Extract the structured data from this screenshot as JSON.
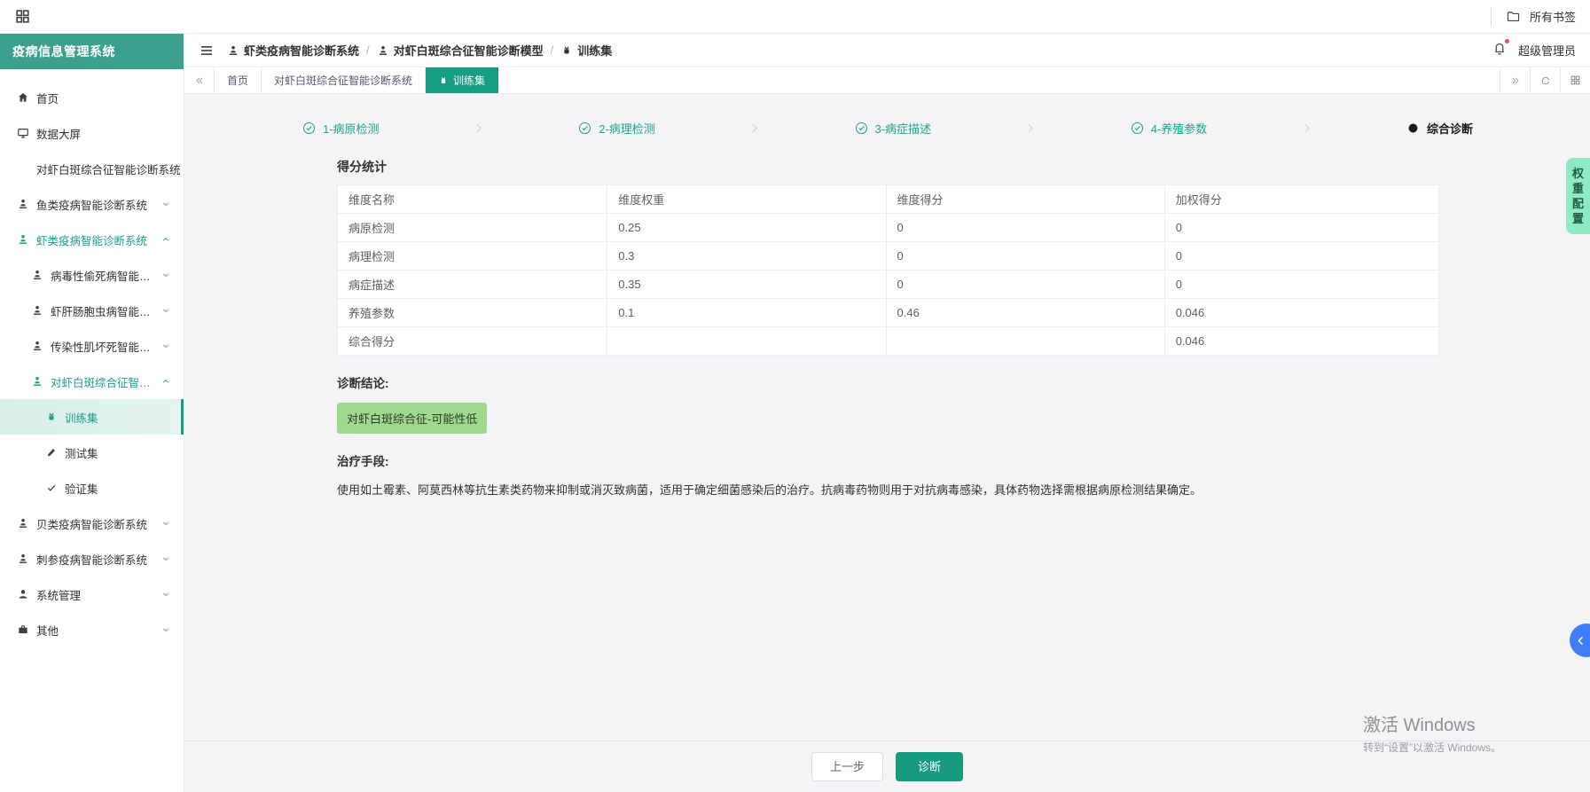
{
  "browser_bar": {
    "bookmarks_label": "所有书签"
  },
  "colors": {
    "teal_header": "#3ca08e",
    "accent": "#189e85",
    "badge_green": "#9fd98d",
    "drawer_blue": "#3f7ef7"
  },
  "sidebar": {
    "title": "疫病信息管理系统",
    "items": [
      {
        "id": "home",
        "label": "首页",
        "icon": "home",
        "level": 1
      },
      {
        "id": "data-screen",
        "label": "数据大屏",
        "icon": "screen",
        "level": 1
      },
      {
        "id": "wssd-system-link",
        "label": "对虾白斑综合征智能诊断系统",
        "icon": null,
        "level": 1
      },
      {
        "id": "fish-system",
        "label": "鱼类疫病智能诊断系统",
        "icon": "model",
        "level": 1,
        "chevron": "down"
      },
      {
        "id": "shrimp-system",
        "label": "虾类疫病智能诊断系统",
        "icon": "model",
        "level": 1,
        "chevron": "up",
        "active": true
      },
      {
        "id": "viral-covert-mortality-model",
        "label": "病毒性偷死病智能诊断模型",
        "icon": "model",
        "level": 2,
        "chevron": "down"
      },
      {
        "id": "ehp-model",
        "label": "虾肝肠胞虫病智能诊断模型",
        "icon": "model",
        "level": 2,
        "chevron": "down"
      },
      {
        "id": "imn-model",
        "label": "传染性肌坏死智能诊断模型",
        "icon": "model",
        "level": 2,
        "chevron": "down"
      },
      {
        "id": "wssd-model",
        "label": "对虾白斑综合征智能诊断模型",
        "icon": "model",
        "level": 2,
        "chevron": "up",
        "active": true
      },
      {
        "id": "training-set",
        "label": "训练集",
        "icon": "android",
        "level": 3,
        "selected": true
      },
      {
        "id": "test-set",
        "label": "测试集",
        "icon": "pencil",
        "level": 3
      },
      {
        "id": "validation-set",
        "label": "验证集",
        "icon": "check",
        "level": 3
      },
      {
        "id": "shellfish-system",
        "label": "贝类疫病智能诊断系统",
        "icon": "model",
        "level": 1,
        "chevron": "down"
      },
      {
        "id": "sea-cucumber-system",
        "label": "刺参疫病智能诊断系统",
        "icon": "model",
        "level": 1,
        "chevron": "down"
      },
      {
        "id": "system-management",
        "label": "系统管理",
        "icon": "user",
        "level": 1,
        "chevron": "down"
      },
      {
        "id": "other",
        "label": "其他",
        "icon": "briefcase",
        "level": 1,
        "chevron": "down"
      }
    ]
  },
  "header": {
    "breadcrumb": [
      {
        "label": "虾类疫病智能诊断系统",
        "icon": "model"
      },
      {
        "label": "对虾白斑综合征智能诊断模型",
        "icon": "model"
      },
      {
        "label": "训练集",
        "icon": "android"
      }
    ],
    "user": "超级管理员"
  },
  "tabs": [
    {
      "id": "home",
      "label": "首页"
    },
    {
      "id": "wssd-system",
      "label": "对虾白斑综合征智能诊断系统"
    },
    {
      "id": "training-set",
      "label": "训练集",
      "icon": "android",
      "active": true
    }
  ],
  "stepper": [
    {
      "id": "pathogen-detection",
      "label": "1-病原检测",
      "state": "done"
    },
    {
      "id": "pathology-detection",
      "label": "2-病理检测",
      "state": "done"
    },
    {
      "id": "symptom-description",
      "label": "3-病症描述",
      "state": "done"
    },
    {
      "id": "farming-parameters",
      "label": "4-养殖参数",
      "state": "done"
    },
    {
      "id": "comprehensive-diagnosis",
      "label": "综合诊断",
      "state": "current"
    }
  ],
  "score_section": {
    "title": "得分统计",
    "table": {
      "headers": [
        "维度名称",
        "维度权重",
        "维度得分",
        "加权得分"
      ],
      "rows": [
        [
          "病原检测",
          "0.25",
          "0",
          "0"
        ],
        [
          "病理检测",
          "0.3",
          "0",
          "0"
        ],
        [
          "病症描述",
          "0.35",
          "0",
          "0"
        ],
        [
          "养殖参数",
          "0.1",
          "0.46",
          "0.046"
        ],
        [
          "综合得分",
          "",
          "",
          "0.046"
        ]
      ]
    }
  },
  "diagnosis": {
    "conclusion_label": "诊断结论:",
    "badge": "对虾白斑综合征-可能性低",
    "treatment_label": "治疗手段:",
    "treatment_text": "使用如土霉素、阿莫西林等抗生素类药物来抑制或消灭致病菌，适用于确定细菌感染后的治疗。抗病毒药物则用于对抗病毒感染，具体药物选择需根据病原检测结果确定。"
  },
  "footer": {
    "prev_label": "上一步",
    "diagnose_label": "诊断"
  },
  "right_edge": {
    "weight_config_label": "权重配置"
  },
  "watermark": {
    "line1": "激活 Windows",
    "line2": "转到“设置”以激活 Windows。"
  }
}
